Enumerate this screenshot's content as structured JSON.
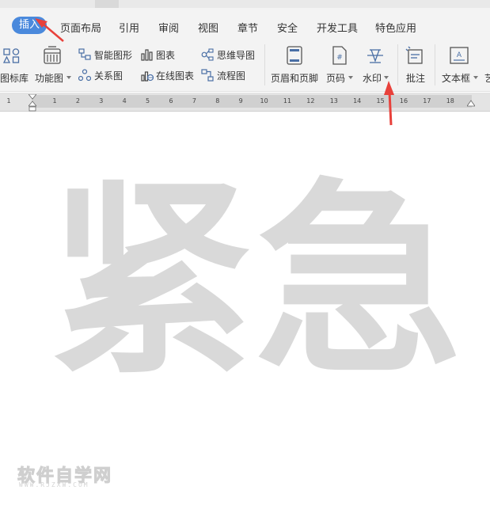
{
  "menu": {
    "tabs": [
      {
        "label": "插入",
        "active": true
      },
      {
        "label": "页面布局"
      },
      {
        "label": "引用"
      },
      {
        "label": "审阅"
      },
      {
        "label": "视图"
      },
      {
        "label": "章节"
      },
      {
        "label": "安全"
      },
      {
        "label": "开发工具"
      },
      {
        "label": "特色应用"
      }
    ]
  },
  "ribbon": {
    "icon_library": "图标库",
    "function_chart": "功能图",
    "smart_art": "智能图形",
    "chart": "图表",
    "mind_map": "思维导图",
    "relation_chart": "关系图",
    "online_chart": "在线图表",
    "flow_chart": "流程图",
    "header_footer": "页眉和页脚",
    "page_number": "页码",
    "watermark": "水印",
    "comment": "批注",
    "text_box": "文本框",
    "cut_off": "艺"
  },
  "ruler": {
    "numbers": [
      "1",
      "1",
      "2",
      "3",
      "4",
      "5",
      "6",
      "7",
      "8",
      "9",
      "10",
      "11",
      "12",
      "13",
      "14",
      "15",
      "16",
      "17",
      "18"
    ]
  },
  "document": {
    "watermark_char_1": "紧",
    "watermark_char_2": "急",
    "site_watermark": "软件自学网",
    "site_url": "WWW.RJZXW.COM"
  },
  "colors": {
    "accent": "#4a89dc",
    "watermark": "#d9d9d9",
    "arrow": "#e8413b"
  }
}
